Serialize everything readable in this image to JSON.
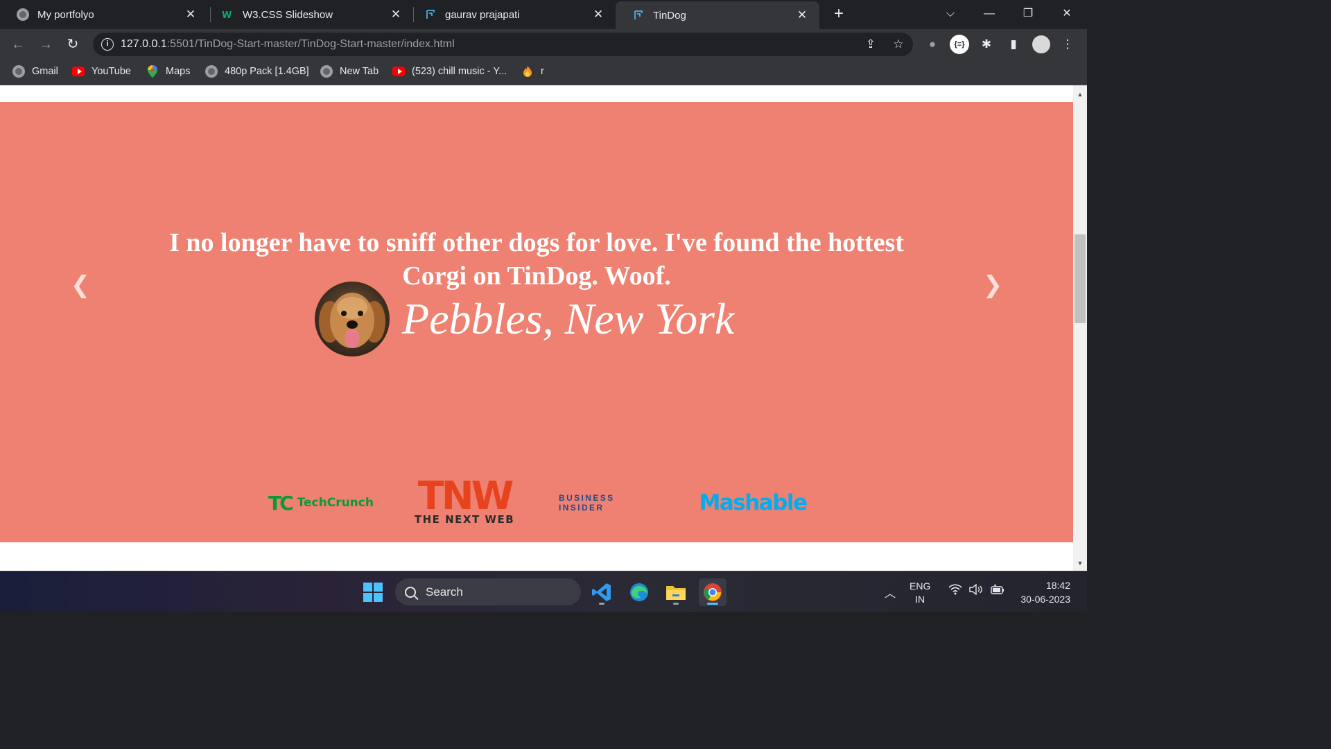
{
  "browser": {
    "tabs": [
      {
        "title": "My portfolyo"
      },
      {
        "title": "W3.CSS Slideshow"
      },
      {
        "title": "gaurav prajapati"
      },
      {
        "title": "TinDog"
      }
    ],
    "new_tab_glyph": "+",
    "close_glyph": "✕",
    "url_host": "127.0.0.1",
    "url_rest": ":5501/TinDog-Start-master/TinDog-Start-master/index.html",
    "bookmarks": [
      {
        "label": "Gmail",
        "icon": "globe-icon"
      },
      {
        "label": "YouTube",
        "icon": "youtube-icon"
      },
      {
        "label": "Maps",
        "icon": "maps-pin-icon"
      },
      {
        "label": "480p Pack [1.4GB]",
        "icon": "globe-icon"
      },
      {
        "label": "New Tab",
        "icon": "globe-icon"
      },
      {
        "label": "(523) chill music - Y...",
        "icon": "youtube-icon"
      },
      {
        "label": "r",
        "icon": "fire-icon"
      }
    ]
  },
  "page": {
    "testimonial": {
      "quote": "I no longer have to sniff other dogs for love. I've found the hottest Corgi on TinDog. Woof.",
      "author": "Pebbles, New York"
    },
    "press": {
      "techcrunch_logo": "TC",
      "techcrunch_name": "TechCrunch",
      "tnw_big": "TNW",
      "tnw_small": "THE NEXT WEB",
      "business_insider": "BUSINESS INSIDER",
      "mashable": "Mashable"
    },
    "colors": {
      "section_bg": "#ef8172",
      "text": "#ffffff"
    }
  },
  "taskbar": {
    "search_label": "Search",
    "lang_1": "ENG",
    "lang_2": "IN",
    "time": "18:42",
    "date": "30-06-2023"
  }
}
